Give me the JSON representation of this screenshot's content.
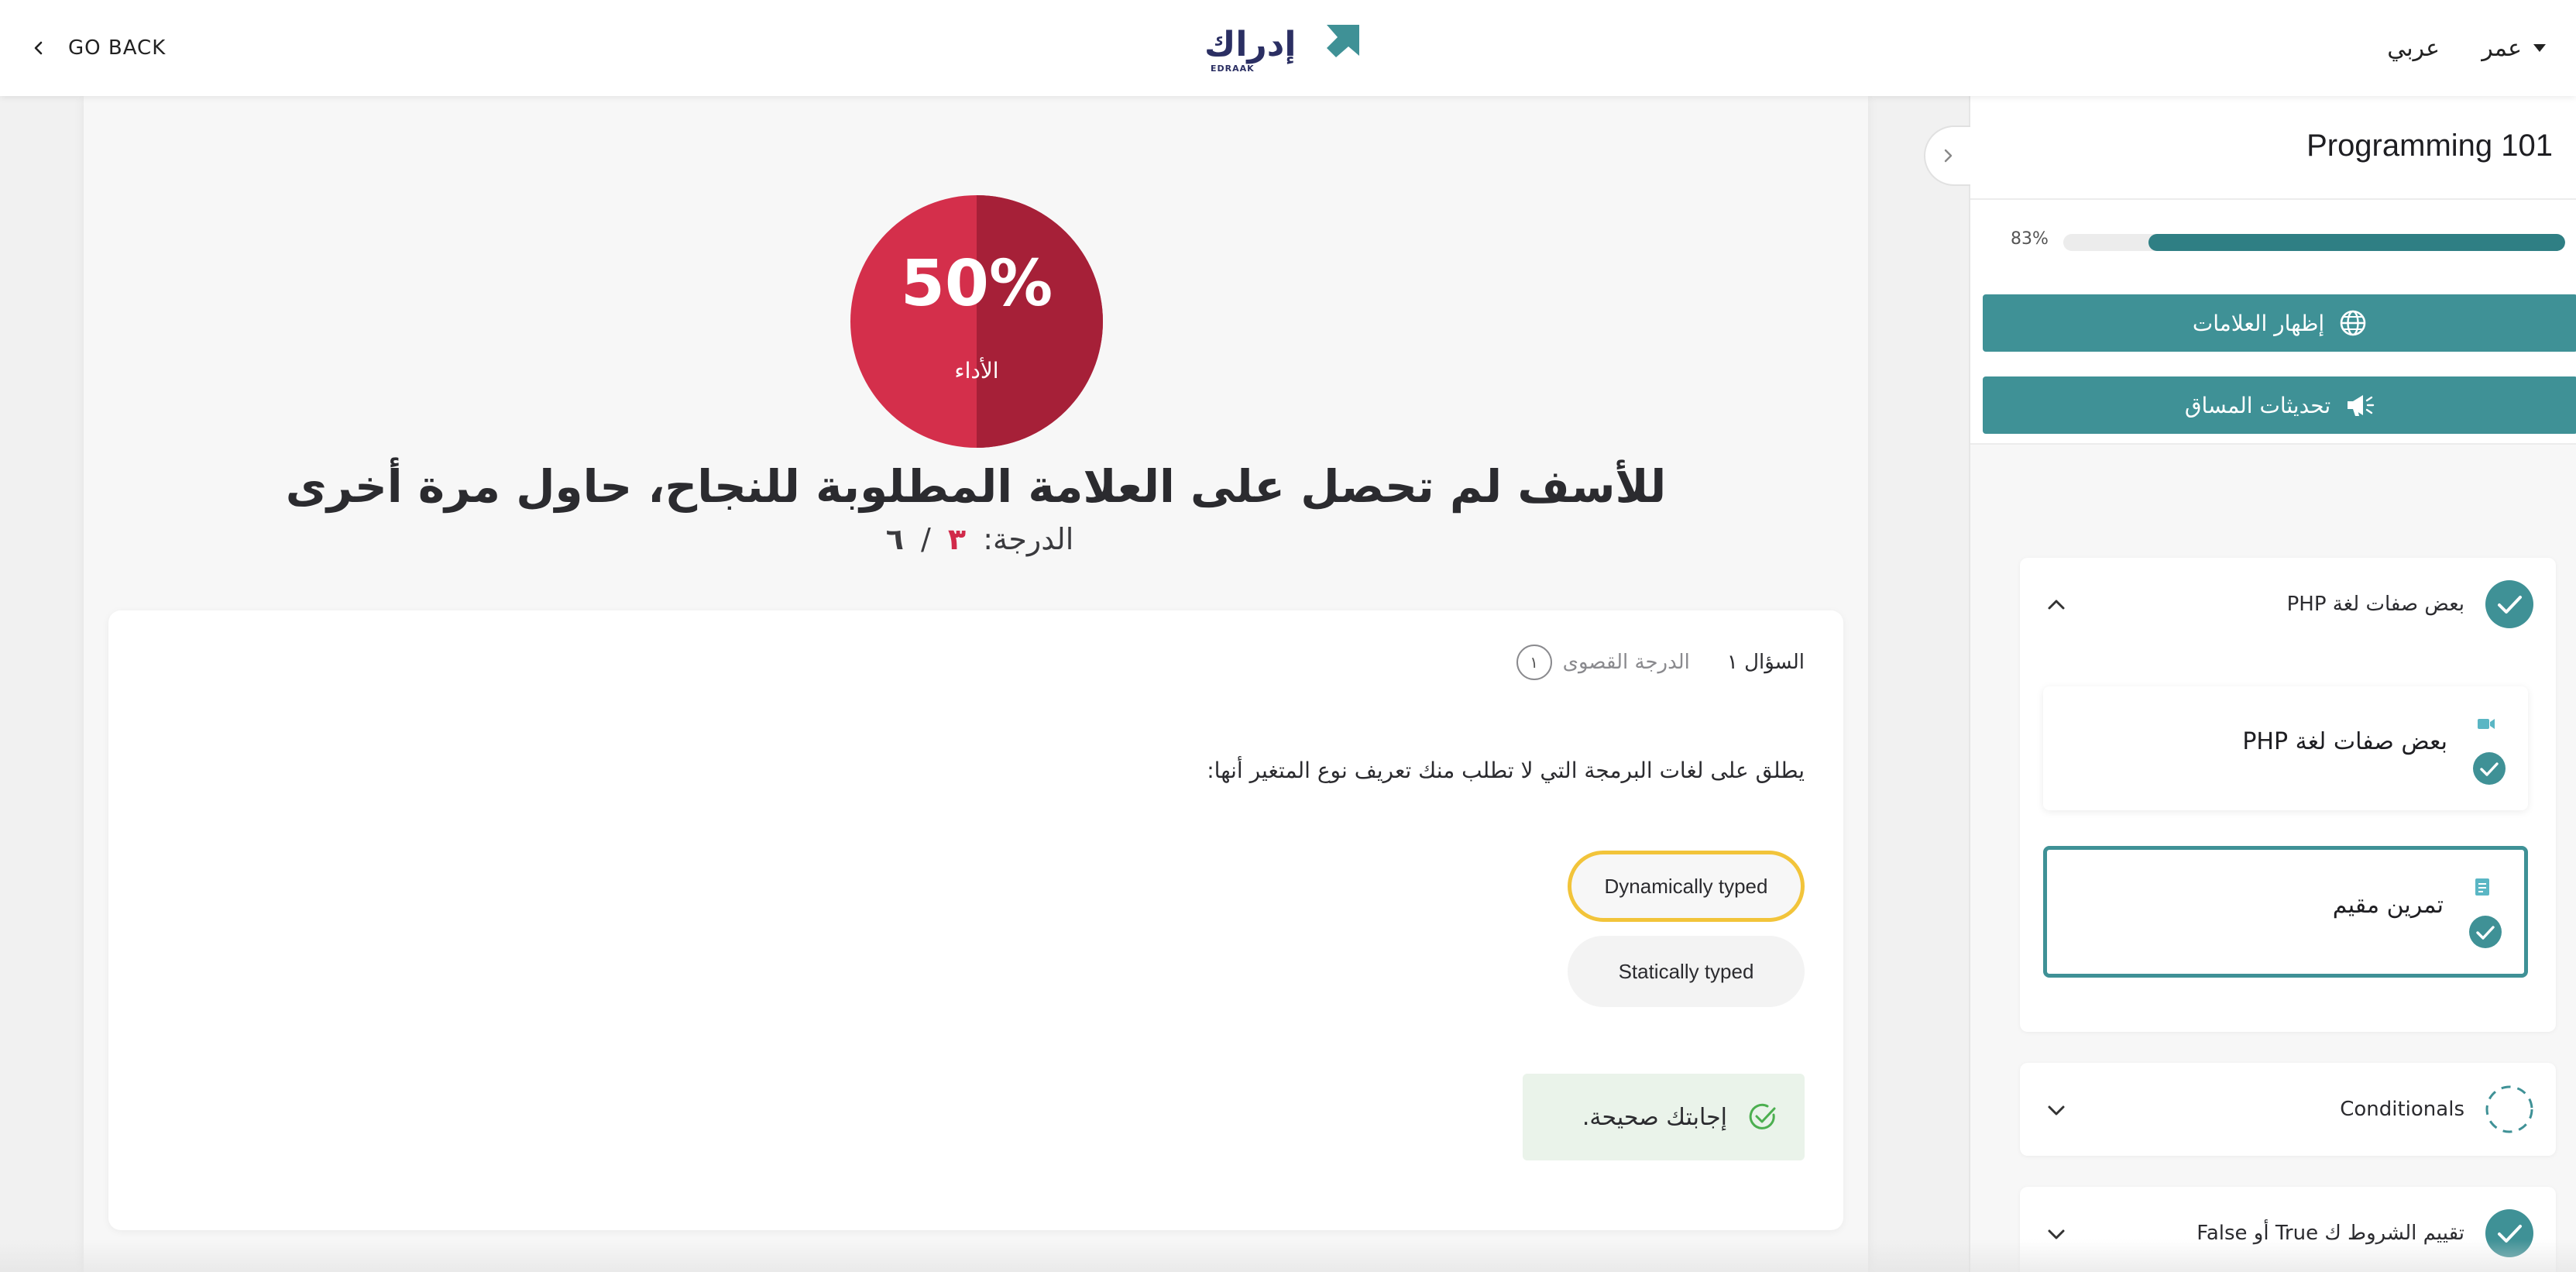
{
  "header": {
    "go_back": "GO BACK",
    "logo_arabic": "إدراك",
    "logo_latin": "EDRAAK",
    "language": "عربي",
    "user_name": "عمر"
  },
  "result": {
    "percent": "50%",
    "percent_label": "الأداء",
    "message": "للأسف لم تحصل على العلامة المطلوبة للنجاح، حاول مرة أخرى",
    "grade_label": "الدرجة:",
    "grade_earned": "٣",
    "grade_sep": "/",
    "grade_total": "٦"
  },
  "question": {
    "label": "السؤال ١",
    "max_label": "الدرجة القصوى",
    "max_value": "١",
    "text": "يطلق على لغات البرمجة التي لا تطلب منك تعريف نوع المتغير أنها:",
    "options": [
      {
        "label": "Dynamically typed",
        "selected": true
      },
      {
        "label": "Statically typed",
        "selected": false
      }
    ],
    "feedback": "إجابتك صحيحة."
  },
  "sidebar": {
    "course_title": "Programming 101",
    "progress_text": "83%",
    "progress_value": 0.83,
    "buttons": {
      "grades": "إظهار العلامات",
      "updates": "تحديثات المساق"
    },
    "sections": [
      {
        "title": "بعض صفات لغة PHP",
        "status": "complete",
        "expanded": true,
        "lessons": [
          {
            "title": "بعض صفات لغة PHP",
            "type": "video",
            "status": "complete",
            "active": false
          },
          {
            "title": "تمرين مقيم",
            "type": "exercise",
            "status": "complete",
            "active": true
          }
        ]
      },
      {
        "title": "Conditionals",
        "status": "in-progress",
        "expanded": false
      },
      {
        "title": "تقييم الشروط ك True أو False",
        "status": "complete",
        "expanded": false
      }
    ]
  },
  "colors": {
    "brand_teal": "#3f9196",
    "progress_fill": "#2f7f84",
    "score_red_light": "#d42f4b",
    "score_red_dark": "#a62038",
    "selected_outline": "#f2c43a",
    "logo_navy": "#2b2f63"
  }
}
